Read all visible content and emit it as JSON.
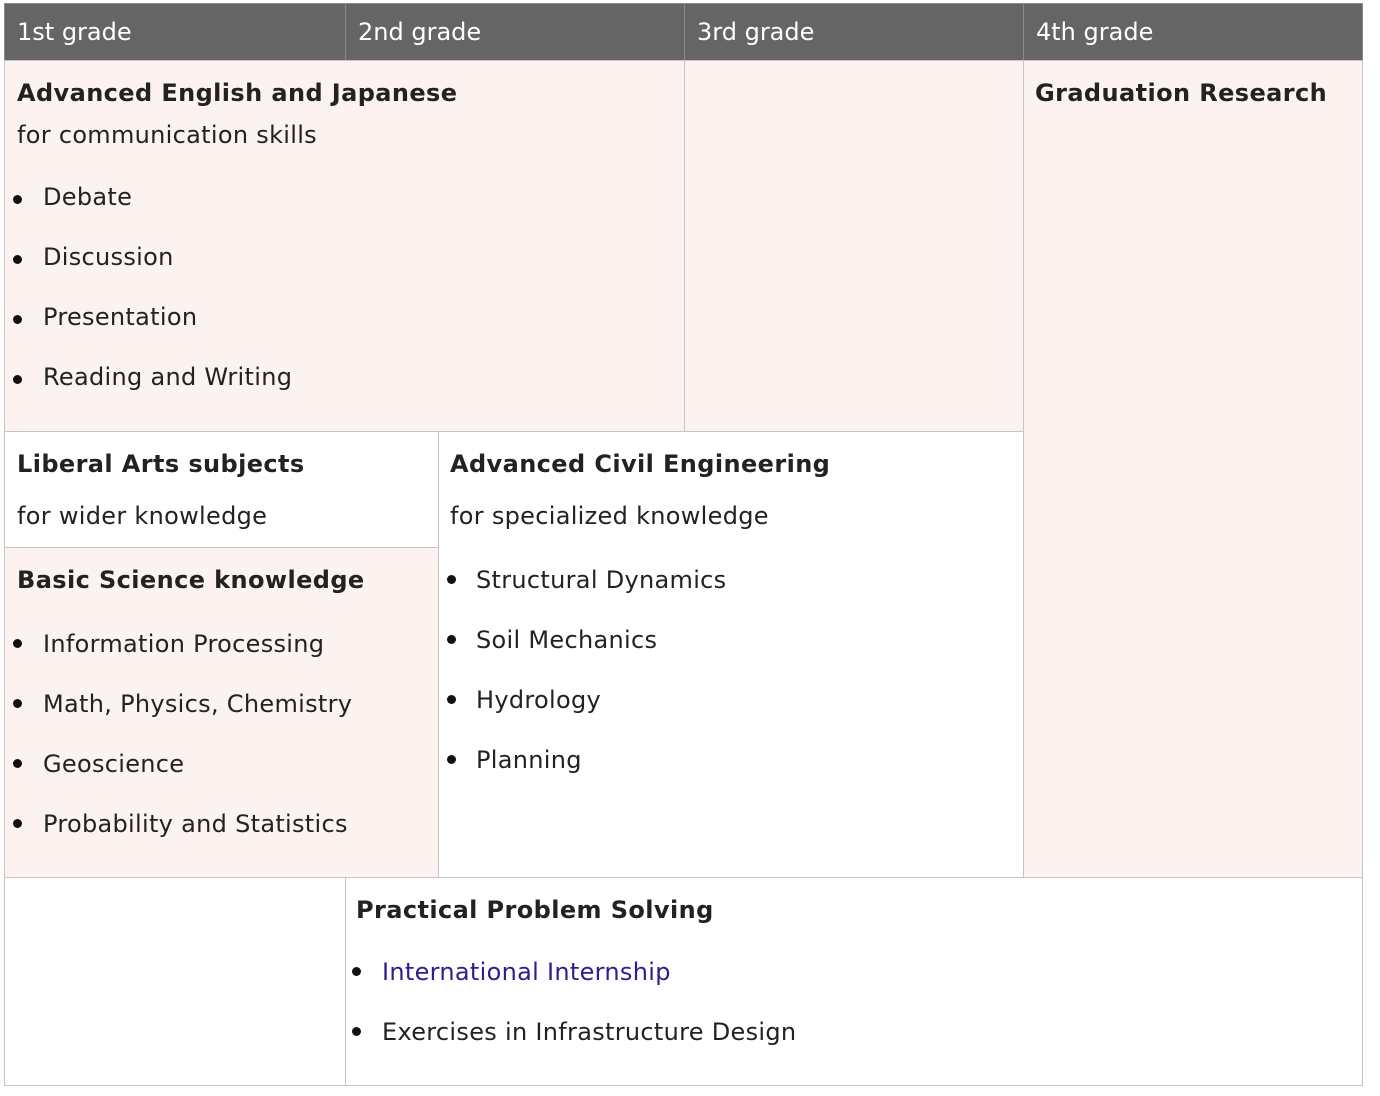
{
  "headers": [
    "1st grade",
    "2nd grade",
    "3rd grade",
    "4th grade"
  ],
  "english": {
    "title": "Advanced English and Japanese",
    "subtitle": "for communication skills",
    "items": [
      "Debate",
      "Discussion",
      "Presentation",
      "Reading and Writing"
    ]
  },
  "graduation": {
    "title": "Graduation Research"
  },
  "liberal": {
    "title": "Liberal Arts subjects",
    "subtitle": "for wider knowledge"
  },
  "civil": {
    "title": "Advanced Civil Engineering",
    "subtitle": "for specialized knowledge",
    "items": [
      "Structural Dynamics",
      "Soil Mechanics",
      "Hydrology",
      "Planning"
    ]
  },
  "science": {
    "title": "Basic Science knowledge",
    "items": [
      "Information Processing",
      "Math, Physics, Chemistry",
      "Geoscience",
      "Probability and Statistics"
    ]
  },
  "practical": {
    "title": "Practical Problem Solving",
    "items": [
      "International Internship",
      "Exercises in Infrastructure Design"
    ]
  },
  "colors": {
    "header_bg": "#656565",
    "cell_pink": "#fcf2ef",
    "link": "#2a1f8f"
  }
}
